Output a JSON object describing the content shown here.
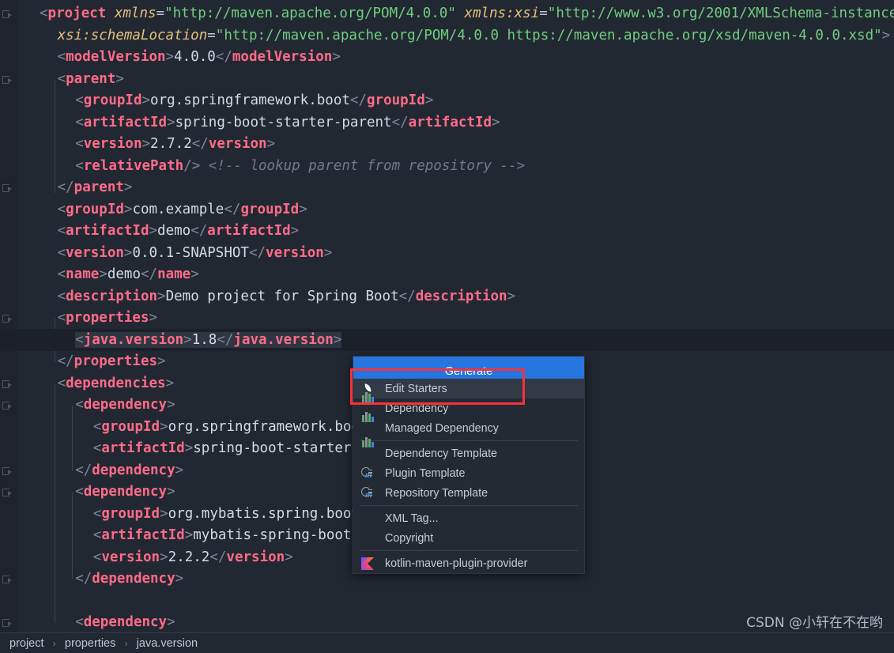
{
  "editor": {
    "language": "xml",
    "background": "#222831",
    "current_line_index": 15,
    "lines": [
      {
        "indent": 0,
        "tokens": [
          {
            "t": "punc",
            "v": "<"
          },
          {
            "t": "tag",
            "v": "project"
          },
          {
            "t": "txt",
            "v": " "
          },
          {
            "t": "attr",
            "v": "xmlns"
          },
          {
            "t": "eq",
            "v": "="
          },
          {
            "t": "str",
            "v": "\"http://maven.apache.org/POM/4.0.0\""
          },
          {
            "t": "txt",
            "v": " "
          },
          {
            "t": "attr",
            "v": "xmlns:xsi"
          },
          {
            "t": "eq",
            "v": "="
          },
          {
            "t": "str",
            "v": "\"http://www.w3.org/2001/XMLSchema-instance\""
          }
        ]
      },
      {
        "indent": 1,
        "tokens": [
          {
            "t": "attr",
            "v": "xsi:schemaLocation"
          },
          {
            "t": "eq",
            "v": "="
          },
          {
            "t": "str",
            "v": "\"http://maven.apache.org/POM/4.0.0 https://maven.apache.org/xsd/maven-4.0.0.xsd\""
          },
          {
            "t": "punc",
            "v": ">"
          }
        ]
      },
      {
        "indent": 1,
        "tokens": [
          {
            "t": "punc",
            "v": "<"
          },
          {
            "t": "tag",
            "v": "modelVersion"
          },
          {
            "t": "punc",
            "v": ">"
          },
          {
            "t": "txt",
            "v": "4.0.0"
          },
          {
            "t": "punc",
            "v": "</"
          },
          {
            "t": "tag",
            "v": "modelVersion"
          },
          {
            "t": "punc",
            "v": ">"
          }
        ]
      },
      {
        "indent": 1,
        "tokens": [
          {
            "t": "punc",
            "v": "<"
          },
          {
            "t": "tag",
            "v": "parent"
          },
          {
            "t": "punc",
            "v": ">"
          }
        ]
      },
      {
        "indent": 2,
        "tokens": [
          {
            "t": "punc",
            "v": "<"
          },
          {
            "t": "tag",
            "v": "groupId"
          },
          {
            "t": "punc",
            "v": ">"
          },
          {
            "t": "txt",
            "v": "org.springframework.boot"
          },
          {
            "t": "punc",
            "v": "</"
          },
          {
            "t": "tag",
            "v": "groupId"
          },
          {
            "t": "punc",
            "v": ">"
          }
        ]
      },
      {
        "indent": 2,
        "tokens": [
          {
            "t": "punc",
            "v": "<"
          },
          {
            "t": "tag",
            "v": "artifactId"
          },
          {
            "t": "punc",
            "v": ">"
          },
          {
            "t": "txt",
            "v": "spring-boot-starter-parent"
          },
          {
            "t": "punc",
            "v": "</"
          },
          {
            "t": "tag",
            "v": "artifactId"
          },
          {
            "t": "punc",
            "v": ">"
          }
        ]
      },
      {
        "indent": 2,
        "tokens": [
          {
            "t": "punc",
            "v": "<"
          },
          {
            "t": "tag",
            "v": "version"
          },
          {
            "t": "punc",
            "v": ">"
          },
          {
            "t": "txt",
            "v": "2.7.2"
          },
          {
            "t": "punc",
            "v": "</"
          },
          {
            "t": "tag",
            "v": "version"
          },
          {
            "t": "punc",
            "v": ">"
          }
        ]
      },
      {
        "indent": 2,
        "tokens": [
          {
            "t": "punc",
            "v": "<"
          },
          {
            "t": "tag",
            "v": "relativePath"
          },
          {
            "t": "punc",
            "v": "/>"
          },
          {
            "t": "txt",
            "v": " "
          },
          {
            "t": "cmt",
            "v": "<!-- lookup parent from repository -->"
          }
        ]
      },
      {
        "indent": 1,
        "tokens": [
          {
            "t": "punc",
            "v": "</"
          },
          {
            "t": "tag",
            "v": "parent"
          },
          {
            "t": "punc",
            "v": ">"
          }
        ]
      },
      {
        "indent": 1,
        "tokens": [
          {
            "t": "punc",
            "v": "<"
          },
          {
            "t": "tag",
            "v": "groupId"
          },
          {
            "t": "punc",
            "v": ">"
          },
          {
            "t": "txt",
            "v": "com.example"
          },
          {
            "t": "punc",
            "v": "</"
          },
          {
            "t": "tag",
            "v": "groupId"
          },
          {
            "t": "punc",
            "v": ">"
          }
        ]
      },
      {
        "indent": 1,
        "tokens": [
          {
            "t": "punc",
            "v": "<"
          },
          {
            "t": "tag",
            "v": "artifactId"
          },
          {
            "t": "punc",
            "v": ">"
          },
          {
            "t": "txt",
            "v": "demo"
          },
          {
            "t": "punc",
            "v": "</"
          },
          {
            "t": "tag",
            "v": "artifactId"
          },
          {
            "t": "punc",
            "v": ">"
          }
        ]
      },
      {
        "indent": 1,
        "tokens": [
          {
            "t": "punc",
            "v": "<"
          },
          {
            "t": "tag",
            "v": "version"
          },
          {
            "t": "punc",
            "v": ">"
          },
          {
            "t": "txt",
            "v": "0.0.1-SNAPSHOT"
          },
          {
            "t": "punc",
            "v": "</"
          },
          {
            "t": "tag",
            "v": "version"
          },
          {
            "t": "punc",
            "v": ">"
          }
        ]
      },
      {
        "indent": 1,
        "tokens": [
          {
            "t": "punc",
            "v": "<"
          },
          {
            "t": "tag",
            "v": "name"
          },
          {
            "t": "punc",
            "v": ">"
          },
          {
            "t": "txt",
            "v": "demo"
          },
          {
            "t": "punc",
            "v": "</"
          },
          {
            "t": "tag",
            "v": "name"
          },
          {
            "t": "punc",
            "v": ">"
          }
        ]
      },
      {
        "indent": 1,
        "tokens": [
          {
            "t": "punc",
            "v": "<"
          },
          {
            "t": "tag",
            "v": "description"
          },
          {
            "t": "punc",
            "v": ">"
          },
          {
            "t": "txt",
            "v": "Demo project for Spring Boot"
          },
          {
            "t": "punc",
            "v": "</"
          },
          {
            "t": "tag",
            "v": "description"
          },
          {
            "t": "punc",
            "v": ">"
          }
        ]
      },
      {
        "indent": 1,
        "tokens": [
          {
            "t": "punc",
            "v": "<"
          },
          {
            "t": "tag",
            "v": "properties"
          },
          {
            "t": "punc",
            "v": ">"
          }
        ]
      },
      {
        "indent": 2,
        "highlighted": true,
        "tokens": [
          {
            "t": "punc hl",
            "v": "<"
          },
          {
            "t": "tag hl",
            "v": "java.version"
          },
          {
            "t": "punc hl",
            "v": ">"
          },
          {
            "t": "txt hl",
            "v": "1.8"
          },
          {
            "t": "punc hl",
            "v": "</"
          },
          {
            "t": "tag hl",
            "v": "java.version"
          },
          {
            "t": "punc hl",
            "v": ">"
          }
        ]
      },
      {
        "indent": 1,
        "tokens": [
          {
            "t": "punc",
            "v": "</"
          },
          {
            "t": "tag",
            "v": "properties"
          },
          {
            "t": "punc",
            "v": ">"
          }
        ]
      },
      {
        "indent": 1,
        "tokens": [
          {
            "t": "punc",
            "v": "<"
          },
          {
            "t": "tag",
            "v": "dependencies"
          },
          {
            "t": "punc",
            "v": ">"
          }
        ]
      },
      {
        "indent": 2,
        "tokens": [
          {
            "t": "punc",
            "v": "<"
          },
          {
            "t": "tag",
            "v": "dependency"
          },
          {
            "t": "punc",
            "v": ">"
          }
        ]
      },
      {
        "indent": 3,
        "tokens": [
          {
            "t": "punc",
            "v": "<"
          },
          {
            "t": "tag",
            "v": "groupId"
          },
          {
            "t": "punc",
            "v": ">"
          },
          {
            "t": "txt",
            "v": "org.springframework.boot"
          },
          {
            "t": "punc",
            "v": "</"
          },
          {
            "t": "tag",
            "v": "groupId"
          },
          {
            "t": "punc",
            "v": ">"
          }
        ]
      },
      {
        "indent": 3,
        "tokens": [
          {
            "t": "punc",
            "v": "<"
          },
          {
            "t": "tag",
            "v": "artifactId"
          },
          {
            "t": "punc",
            "v": ">"
          },
          {
            "t": "txt",
            "v": "spring-boot-starter-web"
          },
          {
            "t": "punc",
            "v": "</"
          },
          {
            "t": "tag",
            "v": "artifactId"
          },
          {
            "t": "punc",
            "v": ">"
          }
        ]
      },
      {
        "indent": 2,
        "tokens": [
          {
            "t": "punc",
            "v": "</"
          },
          {
            "t": "tag",
            "v": "dependency"
          },
          {
            "t": "punc",
            "v": ">"
          }
        ]
      },
      {
        "indent": 2,
        "tokens": [
          {
            "t": "punc",
            "v": "<"
          },
          {
            "t": "tag",
            "v": "dependency"
          },
          {
            "t": "punc",
            "v": ">"
          }
        ]
      },
      {
        "indent": 3,
        "tokens": [
          {
            "t": "punc",
            "v": "<"
          },
          {
            "t": "tag",
            "v": "groupId"
          },
          {
            "t": "punc",
            "v": ">"
          },
          {
            "t": "txt",
            "v": "org.mybatis.spring.boot"
          },
          {
            "t": "punc",
            "v": "</"
          },
          {
            "t": "tag",
            "v": "groupId"
          },
          {
            "t": "punc",
            "v": ">"
          }
        ]
      },
      {
        "indent": 3,
        "tokens": [
          {
            "t": "punc",
            "v": "<"
          },
          {
            "t": "tag",
            "v": "artifactId"
          },
          {
            "t": "punc",
            "v": ">"
          },
          {
            "t": "txt",
            "v": "mybatis-spring-boot-starter"
          },
          {
            "t": "punc",
            "v": "</"
          },
          {
            "t": "tag",
            "v": "artifactId"
          },
          {
            "t": "punc",
            "v": ">"
          }
        ]
      },
      {
        "indent": 3,
        "tokens": [
          {
            "t": "punc",
            "v": "<"
          },
          {
            "t": "tag",
            "v": "version"
          },
          {
            "t": "punc",
            "v": ">"
          },
          {
            "t": "txt",
            "v": "2.2.2"
          },
          {
            "t": "punc",
            "v": "</"
          },
          {
            "t": "tag",
            "v": "version"
          },
          {
            "t": "punc",
            "v": ">"
          }
        ]
      },
      {
        "indent": 2,
        "tokens": [
          {
            "t": "punc",
            "v": "</"
          },
          {
            "t": "tag",
            "v": "dependency"
          },
          {
            "t": "punc",
            "v": ">"
          }
        ]
      },
      {
        "indent": 0,
        "tokens": []
      },
      {
        "indent": 2,
        "tokens": [
          {
            "t": "punc",
            "v": "<"
          },
          {
            "t": "tag",
            "v": "dependency"
          },
          {
            "t": "punc",
            "v": ">"
          }
        ]
      }
    ]
  },
  "popup": {
    "header_label": "Generate",
    "items": [
      {
        "label": "Edit Starters",
        "icon": "spring-leaf-icon",
        "selected": true,
        "sep_after": false
      },
      {
        "label": "Dependency",
        "icon": "dependency-bars-icon",
        "selected": false,
        "sep_after": false
      },
      {
        "label": "Managed Dependency",
        "icon": "dependency-bars-icon",
        "selected": false,
        "sep_after": true
      },
      {
        "label": "Dependency Template",
        "icon": "dependency-bars-icon",
        "selected": false,
        "sep_after": false
      },
      {
        "label": "Plugin Template",
        "icon": "maven-plugin-icon",
        "selected": false,
        "sep_after": false
      },
      {
        "label": "Repository Template",
        "icon": "maven-plugin-icon",
        "selected": false,
        "sep_after": true
      },
      {
        "label": "XML Tag...",
        "icon": "none",
        "selected": false,
        "sep_after": false
      },
      {
        "label": "Copyright",
        "icon": "none",
        "selected": false,
        "sep_after": true
      },
      {
        "label": "kotlin-maven-plugin-provider",
        "icon": "kotlin-icon",
        "selected": false,
        "sep_after": false
      }
    ]
  },
  "annotation": {
    "color": "#f6323c",
    "target": "Edit Starters"
  },
  "breadcrumb": {
    "items": [
      "project",
      "properties",
      "java.version"
    ],
    "separator": "›"
  },
  "watermark": {
    "text": "CSDN @小轩在不在哟"
  },
  "colors": {
    "editor_bg": "#222831",
    "gutter_bg": "#1e232c",
    "current_line": "#1c2029",
    "tag": "#ff6b8a",
    "attribute": "#e5c07b",
    "string": "#6fcf7f",
    "text": "#d5dbe5",
    "comment": "#707a8c",
    "popup_header": "#2675e0",
    "popup_bg": "#242a33",
    "selection": "#323a46",
    "annotation": "#f6323c"
  }
}
